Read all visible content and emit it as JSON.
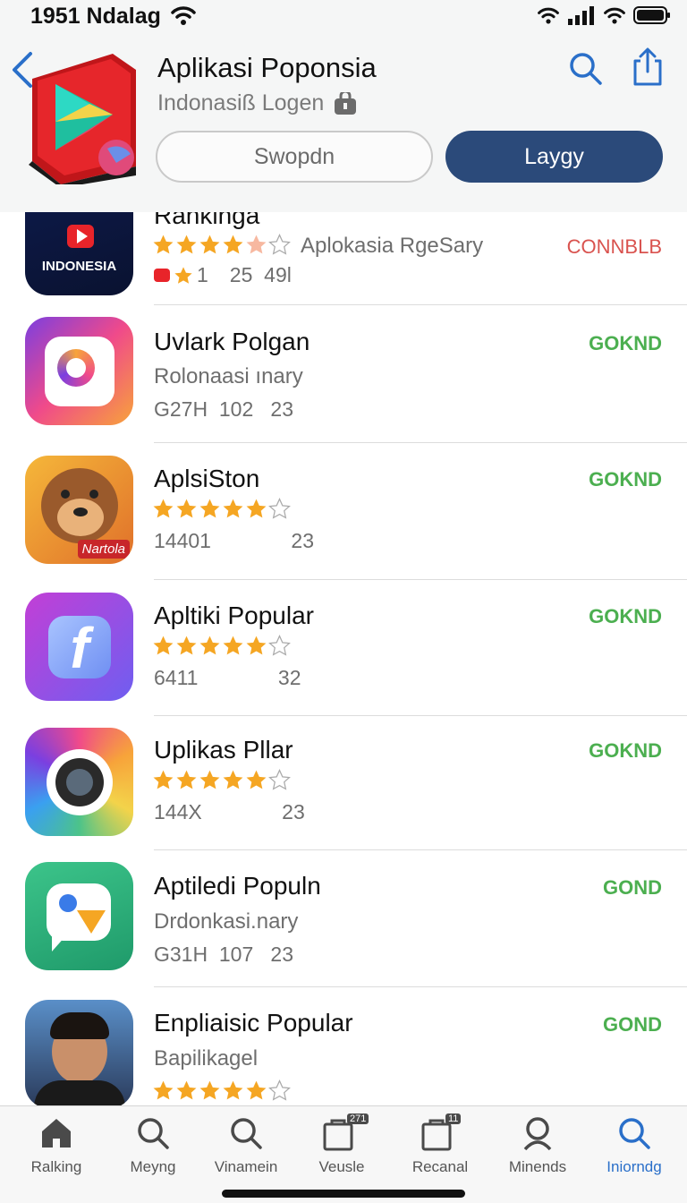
{
  "status_bar": {
    "time": "1951 Ndalag"
  },
  "header": {
    "title": "Aplikasi Poponsia",
    "subtitle": "Indonasiß Logen",
    "outline_button": "Swopdn",
    "filled_button": "Laygy"
  },
  "list": {
    "items": [
      {
        "title": "Rankinga",
        "sub": "Aplokasia RgeSary",
        "meta_count": "1",
        "meta": "25  49l",
        "action": "CONNBLB",
        "action_color": "#d9534f",
        "stars": 4.5
      },
      {
        "title": "Uvlark Polgan",
        "sub": "Rolonaasi ınary",
        "meta": "G27H  102   23",
        "action": "GOKND",
        "action_color": "#4caf50"
      },
      {
        "title": "AplsiSton",
        "meta": "14401              23",
        "action": "GOKND",
        "action_color": "#4caf50",
        "stars": 5
      },
      {
        "title": "Apltiki Popular",
        "meta": "6411              32",
        "action": "GOKND",
        "action_color": "#4caf50",
        "stars": 5
      },
      {
        "title": "Uplikas Pllar",
        "meta": "144X              23",
        "action": "GOKND",
        "action_color": "#4caf50",
        "stars": 5
      },
      {
        "title": "Aptiledi Populn",
        "sub": "Drdonkasi.nary",
        "meta": "G31H  107   23",
        "action": "GOND",
        "action_color": "#4caf50"
      },
      {
        "title": "Enpliaisic Popular",
        "sub": "Bapilikagel",
        "action": "GOND",
        "action_color": "#4caf50",
        "stars": 5
      }
    ],
    "icon_labels": {
      "indonesia": "INDONESIA",
      "mascot": "Nartola"
    }
  },
  "tabs": [
    {
      "label": "Ralking",
      "icon": "home-icon"
    },
    {
      "label": "Meyng",
      "icon": "search-icon"
    },
    {
      "label": "Vinamein",
      "icon": "search-icon"
    },
    {
      "label": "Veusle",
      "icon": "bag-icon",
      "badge": "271"
    },
    {
      "label": "Recanal",
      "icon": "bag-icon",
      "badge": "11"
    },
    {
      "label": "Minends",
      "icon": "person-icon"
    },
    {
      "label": "Iniorndg",
      "icon": "search-icon",
      "active": true
    }
  ],
  "colors": {
    "accent": "#2b4a7a",
    "active_tab": "#2a6fc9",
    "star": "#f5a623",
    "get_green": "#4caf50",
    "red_action": "#d9534f"
  }
}
